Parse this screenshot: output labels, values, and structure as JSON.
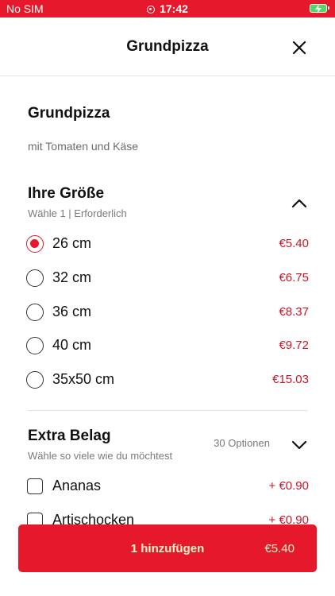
{
  "status_bar": {
    "carrier": "No SIM",
    "time": "17:42",
    "battery_color": "#53d769"
  },
  "header": {
    "title": "Grundpizza",
    "close_icon": "close-icon"
  },
  "product": {
    "name": "Grundpizza",
    "description": "mit Tomaten und Käse"
  },
  "size_section": {
    "title": "Ihre Größe",
    "subtitle": "Wähle 1  |  Erforderlich",
    "expanded": true,
    "options": [
      {
        "label": "26 cm",
        "price": "€5.40",
        "selected": true
      },
      {
        "label": "32 cm",
        "price": "€6.75",
        "selected": false
      },
      {
        "label": "36 cm",
        "price": "€8.37",
        "selected": false
      },
      {
        "label": "40 cm",
        "price": "€9.72",
        "selected": false
      },
      {
        "label": "35x50 cm",
        "price": "€15.03",
        "selected": false
      }
    ]
  },
  "extra_section": {
    "title": "Extra Belag",
    "subtitle": "Wähle so viele wie du möchtest",
    "options_count": "30 Optionen",
    "expanded": false,
    "options": [
      {
        "label": "Ananas",
        "price": "+ €0.90",
        "checked": false
      },
      {
        "label": "Artischocken",
        "price": "+ €0.90",
        "checked": false
      }
    ]
  },
  "add_button": {
    "label": "1 hinzufügen",
    "price": "€5.40"
  },
  "colors": {
    "brand_red": "#e5192b",
    "price_red": "#d01327",
    "button_text": "#fff6c5"
  }
}
